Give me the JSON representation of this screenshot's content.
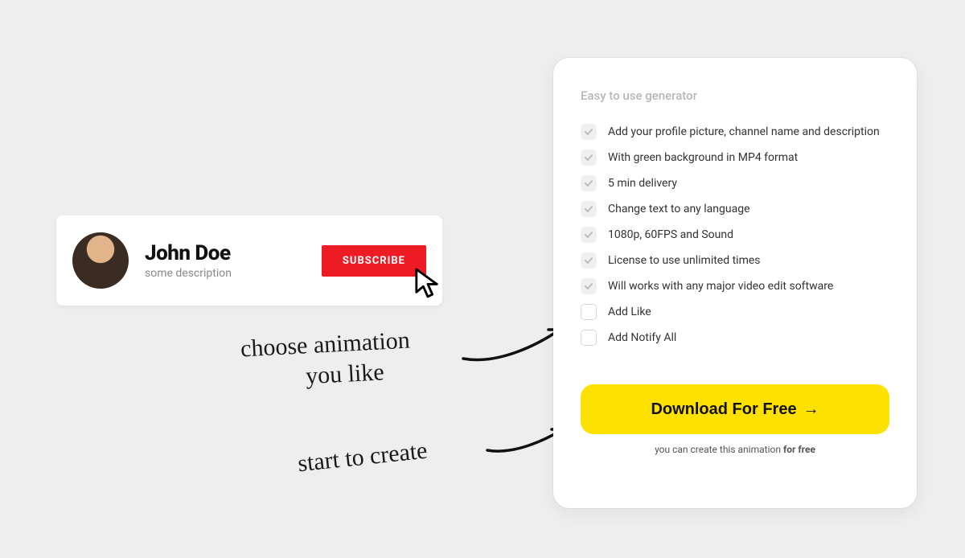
{
  "preview": {
    "channel_name": "John Doe",
    "channel_desc": "some description",
    "subscribe_label": "SUBSCRIBE"
  },
  "annotations": {
    "choose": "choose animation\n      you like",
    "start": "start to create"
  },
  "panel": {
    "title": "Easy to use generator",
    "features": [
      {
        "label": "Add your profile picture, channel name and description",
        "checked": true
      },
      {
        "label": "With green background in MP4 format",
        "checked": true
      },
      {
        "label": "5 min delivery",
        "checked": true
      },
      {
        "label": "Change text to any language",
        "checked": true
      },
      {
        "label": "1080p, 60FPS and Sound",
        "checked": true
      },
      {
        "label": "License to use unlimited times",
        "checked": true
      },
      {
        "label": "Will works with any major video edit software",
        "checked": true
      },
      {
        "label": "Add Like",
        "checked": false
      },
      {
        "label": "Add Notify All",
        "checked": false
      }
    ],
    "download_label": "Download For Free",
    "download_arrow": "→",
    "footnote_prefix": "you can create this animation ",
    "footnote_bold": "for free"
  }
}
